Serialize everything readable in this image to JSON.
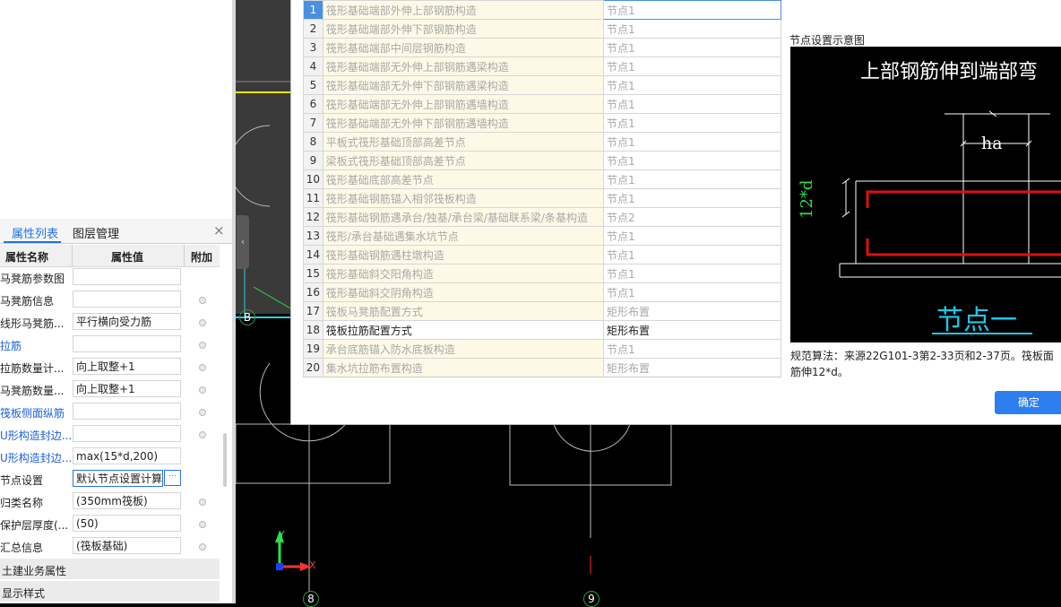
{
  "left_panel": {
    "tabs": {
      "properties": "属性列表",
      "layers": "图层管理",
      "close": "×"
    },
    "headers": {
      "name": "属性名称",
      "value": "属性值",
      "extra": "附加"
    },
    "rows": [
      {
        "name": "马凳筋参数图",
        "value": ""
      },
      {
        "name": "马凳筋信息",
        "value": ""
      },
      {
        "name": "线形马凳筋...",
        "value": "平行横向受力筋"
      },
      {
        "name": "拉筋",
        "value": ""
      },
      {
        "name": "拉筋数量计...",
        "value": "向上取整+1"
      },
      {
        "name": "马凳筋数量...",
        "value": "向上取整+1"
      },
      {
        "name": "筏板侧面纵筋",
        "value": ""
      },
      {
        "name": "U形构造封边...",
        "value": ""
      },
      {
        "name": "U形构造封边...",
        "value": "max(15*d,200)"
      },
      {
        "name": "节点设置",
        "value": "默认节点设置计算",
        "button": "···"
      },
      {
        "name": "归类名称",
        "value": "(350mm筏板)"
      },
      {
        "name": "保护层厚度(...",
        "value": "(50)"
      },
      {
        "name": "汇总信息",
        "value": "(筏板基础)"
      }
    ],
    "groups": [
      "土建业务属性",
      "显示样式"
    ]
  },
  "canvas": {
    "collapse_glyph": "‹",
    "axis_y": "Y",
    "axis_x": "X",
    "grid_labels": {
      "b": "B",
      "g8": "8",
      "g9": "9"
    }
  },
  "dialog": {
    "nodes": [
      {
        "index": "1",
        "name": "筏形基础端部外伸上部钢筋构造",
        "value": "节点1"
      },
      {
        "index": "2",
        "name": "筏形基础端部外伸下部钢筋构造",
        "value": "节点1"
      },
      {
        "index": "3",
        "name": "筏形基础端部中间层钢筋构造",
        "value": "节点1"
      },
      {
        "index": "4",
        "name": "筏形基础端部无外伸上部钢筋遇梁构造",
        "value": "节点1"
      },
      {
        "index": "5",
        "name": "筏形基础端部无外伸下部钢筋遇梁构造",
        "value": "节点1"
      },
      {
        "index": "6",
        "name": "筏形基础端部无外伸上部钢筋遇墙构造",
        "value": "节点1"
      },
      {
        "index": "7",
        "name": "筏形基础端部无外伸下部钢筋遇墙构造",
        "value": "节点1"
      },
      {
        "index": "8",
        "name": "平板式筏形基础顶部高差节点",
        "value": "节点1"
      },
      {
        "index": "9",
        "name": "梁板式筏形基础顶部高差节点",
        "value": "节点1"
      },
      {
        "index": "10",
        "name": "筏形基础底部高差节点",
        "value": "节点1"
      },
      {
        "index": "11",
        "name": "筏形基础钢筋锚入相邻筏板构造",
        "value": "节点1"
      },
      {
        "index": "12",
        "name": "筏形基础钢筋遇承台/独基/承台梁/基础联系梁/条基构造",
        "value": "节点2"
      },
      {
        "index": "13",
        "name": "筏形/承台基础遇集水坑节点",
        "value": "节点1"
      },
      {
        "index": "14",
        "name": "筏形基础钢筋遇柱墩构造",
        "value": "节点1"
      },
      {
        "index": "15",
        "name": "筏形基础斜交阳角构造",
        "value": "节点1"
      },
      {
        "index": "16",
        "name": "筏形基础斜交阴角构造",
        "value": "节点1"
      },
      {
        "index": "17",
        "name": "筏板马凳筋配置方式",
        "value": "矩形布置"
      },
      {
        "index": "18",
        "name": "筏板拉筋配置方式",
        "value": "矩形布置"
      },
      {
        "index": "19",
        "name": "承台底筋锚入防水底板构造",
        "value": "节点1"
      },
      {
        "index": "20",
        "name": "集水坑拉筋布置构造",
        "value": "矩形布置"
      }
    ],
    "schematic_label": "节点设置示意图",
    "schematic": {
      "title": "上部钢筋伸到端部弯",
      "ha": "ha",
      "dim": "12*d",
      "node_name": "节点一"
    },
    "rule_text": "规范算法：来源22G101-3第2-33页和2-37页。筏板面筋伸12*d。",
    "ok_label": "确定"
  }
}
